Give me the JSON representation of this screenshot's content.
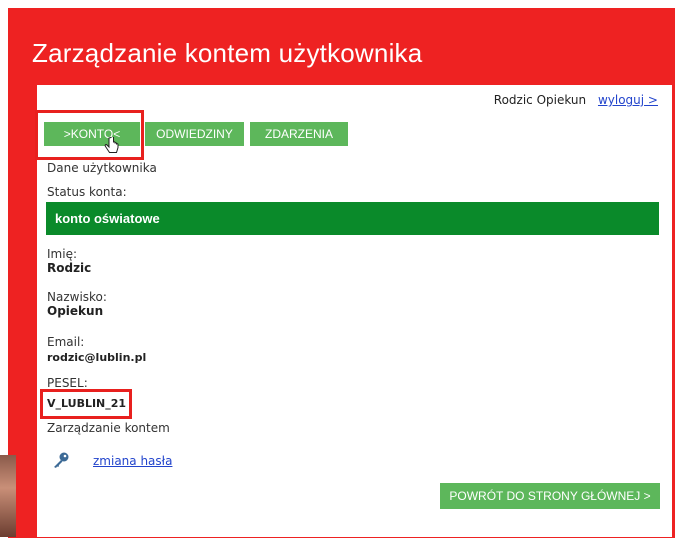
{
  "page": {
    "title": "Zarządzanie kontem użytkownika"
  },
  "user": {
    "name": "Rodzic Opiekun",
    "logout_label": "wyloguj >"
  },
  "tabs": [
    {
      "label": ">KONTO<"
    },
    {
      "label": "ODWIEDZINY"
    },
    {
      "label": "ZDARZENIA"
    }
  ],
  "section": {
    "heading": "Dane użytkownika"
  },
  "status": {
    "label": "Status konta:",
    "value": "konto oświatowe"
  },
  "fields": {
    "first_name": {
      "label": "Imię:",
      "value": "Rodzic"
    },
    "last_name": {
      "label": "Nazwisko:",
      "value": "Opiekun"
    },
    "email": {
      "label": "Email:",
      "value": "rodzic@lublin.pl"
    },
    "pesel": {
      "label": "PESEL:",
      "value": "V_LUBLIN_21"
    }
  },
  "account_mgmt": {
    "heading": "Zarządzanie kontem",
    "change_password": "zmiana hasła"
  },
  "back_button": {
    "label": "POWRÓT DO STRONY GŁÓWNEJ >"
  },
  "colors": {
    "brand_red": "#ee2222",
    "button_green": "#5db75b",
    "status_green": "#0a8a2a"
  },
  "icons": {
    "key": "key-icon",
    "cursor": "hand-pointer-icon"
  }
}
